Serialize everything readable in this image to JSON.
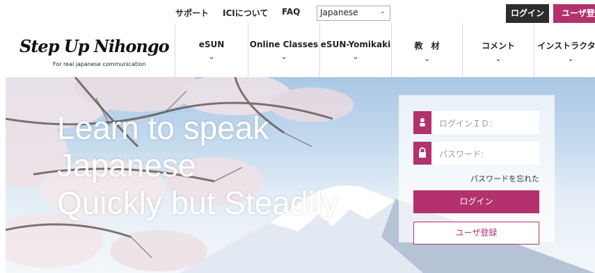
{
  "topbar": {
    "support": "サポート",
    "about": "ICIについて",
    "faq": "FAQ",
    "language_selected": "Japanese",
    "login": "ログイン",
    "register": "ユーザ登録"
  },
  "logo": {
    "text": "Step Up Nihongo",
    "tagline": "For real japanese communication"
  },
  "nav": {
    "items": [
      {
        "label": "eSUN"
      },
      {
        "label": "Online Classes"
      },
      {
        "label": "eSUN-Yomikaki"
      },
      {
        "label": "教　材"
      },
      {
        "label": "コメント"
      },
      {
        "label": "インストラクター"
      }
    ]
  },
  "hero": {
    "line1": "Learn to speak",
    "line2": "Japanese",
    "line3": "Quickly but Steadily"
  },
  "login_form": {
    "id_placeholder": "ログインＩＤ:",
    "password_placeholder": "パスワード:",
    "forgot": "パスワードを忘れた",
    "login_button": "ログイン",
    "register_button": "ユーザ登録"
  },
  "colors": {
    "accent": "#b3326d",
    "dark": "#2d2d2d"
  },
  "icons": {
    "user": "user-icon",
    "lock": "lock-icon",
    "chevron": "chevron-down-icon"
  }
}
